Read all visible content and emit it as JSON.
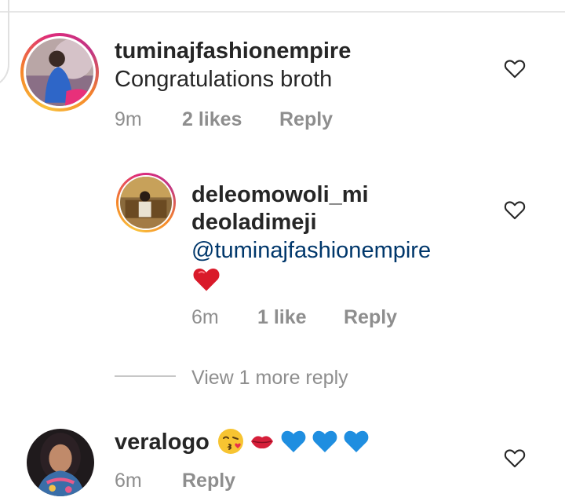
{
  "comments": [
    {
      "username": "tuminajfashionempire",
      "text": "Congratulations broth",
      "time": "9m",
      "likes": "2 likes",
      "reply_label": "Reply",
      "like_icon": "heart-outline-icon"
    }
  ],
  "reply": {
    "username_line1": "deleomowoli_mi",
    "username_line2": "deoladimeji",
    "mention": "@tuminajfashionempire",
    "emoji": "red-heart-emoji",
    "time": "6m",
    "likes": "1 like",
    "reply_label": "Reply",
    "like_icon": "heart-outline-icon"
  },
  "view_more": {
    "label": "View 1 more reply"
  },
  "second_comment": {
    "username": "veralogo",
    "emojis": [
      "kissing-face-emoji",
      "kiss-lips-emoji",
      "blue-heart-emoji",
      "blue-heart-emoji",
      "blue-heart-emoji"
    ],
    "time": "6m",
    "reply_label": "Reply",
    "like_icon": "heart-outline-icon"
  },
  "colors": {
    "text": "#262626",
    "secondary": "#8e8e8e",
    "mention": "#00376b",
    "divider": "#e6e6e6"
  }
}
